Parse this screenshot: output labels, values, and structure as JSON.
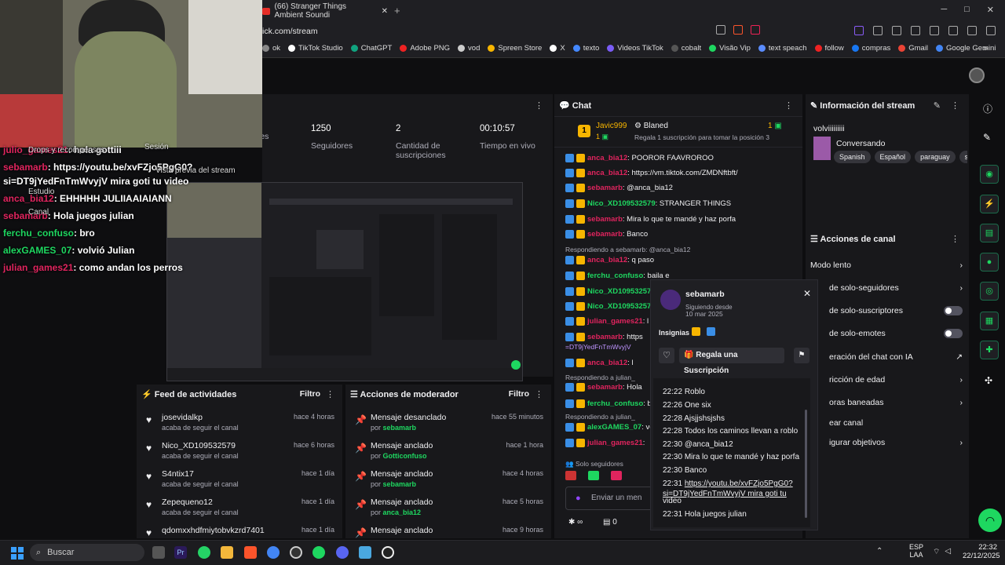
{
  "browser": {
    "tab_title": "(66) Stranger Things Ambient Soundi",
    "new_tab": "+",
    "url": "ick.com/stream",
    "window_controls": [
      "─",
      "□",
      "✕"
    ],
    "bookmarks": [
      "ok",
      "TikTok Studio",
      "ChatGPT",
      "Adobe PNG",
      "vod",
      "Spreen Store",
      "X",
      "texto",
      "Videos TikTok",
      "cobalt",
      "Visão Vip",
      "text speach",
      "follow",
      "compras",
      "Gmail",
      "Google Gemini"
    ]
  },
  "stats": {
    "items": [
      {
        "value": "",
        "label": "ores"
      },
      {
        "value": "1250",
        "label": "Seguidores"
      },
      {
        "value": "2",
        "label": "Cantidad de suscripciones"
      },
      {
        "value": "00:10:57",
        "label": "Tiempo en vivo"
      }
    ]
  },
  "overlay_chat": [
    {
      "user": "julio_games21",
      "text": ": hola gottiii",
      "color": "#e0245e"
    },
    {
      "user": "sebamarb",
      "text": ": https://youtu.be/xvFZjo5PgG0?",
      "color": "#e0245e"
    },
    {
      "user": "",
      "text": "si=DT9jYedFnTmWvyjV mira goti tu video",
      "color": "#fff"
    },
    {
      "user": "anca_bia12",
      "text": ": EHHHHH JULIIAAIAIANN",
      "color": "#e0245e"
    },
    {
      "user": "sebamarb",
      "text": ": Hola juegos julian",
      "color": "#e0245e"
    },
    {
      "user": "ferchu_confuso",
      "text": ": bro",
      "color": "#1ed760"
    },
    {
      "user": "alexGAMES_07",
      "text": ": volvió Julian",
      "color": "#1ed760"
    },
    {
      "user": "julian_games21",
      "text": ": como andan los perros",
      "color": "#e0245e"
    }
  ],
  "overlay_menu": [
    "Drops y recompensas",
    "Vista previa del stream",
    "Estudio",
    "Canal",
    "Sesión"
  ],
  "chat": {
    "title": "Chat",
    "top_user": "Javic999",
    "top_rank": "1",
    "top_badge": "Blaned",
    "top_count": "1",
    "top_cta": "Regala 1 suscripción para tomar la posición 3",
    "lines": [
      {
        "user": "anca_bia12",
        "text": ": POOROR FAAVROROO",
        "ucolor": "#e0245e"
      },
      {
        "user": "anca_bia12",
        "text": ": https://vm.tiktok.com/ZMDNftbft/",
        "ucolor": "#e0245e"
      },
      {
        "user": "sebamarb",
        "text": ": @anca_bia12",
        "ucolor": "#e0245e"
      },
      {
        "user": "Nico_XD109532579",
        "text": ": STRANGER THINGS",
        "ucolor": "#1ed760"
      },
      {
        "user": "sebamarb",
        "text": ": Mira lo que te mandé y haz porfa",
        "ucolor": "#e0245e"
      },
      {
        "user": "sebamarb",
        "text": ": Banco",
        "ucolor": "#e0245e"
      },
      {
        "user": "",
        "text": "Respondiendo a sebamarb: @anca_bia12",
        "ucolor": "#adadb8"
      },
      {
        "user": "anca_bia12",
        "text": ": q paso",
        "ucolor": "#e0245e"
      },
      {
        "user": "ferchu_confuso",
        "text": ": baila e",
        "ucolor": "#1ed760"
      },
      {
        "user": "Nico_XD109532579",
        "text": ": nc",
        "ucolor": "#1ed760"
      },
      {
        "user": "Nico_XD109532579",
        "text": ": /p",
        "ucolor": "#1ed760"
      },
      {
        "user": "julian_games21",
        "text": ": l",
        "ucolor": "#e0245e"
      },
      {
        "user": "sebamarb",
        "text": ": https",
        "ucolor": "#e0245e"
      },
      {
        "user": "",
        "text": "=DT9jYedFnTmWvyjV",
        "ucolor": "#bf94ff"
      },
      {
        "user": "anca_bia12",
        "text": ": l",
        "ucolor": "#e0245e"
      },
      {
        "user": "",
        "text": "Respondiendo a julian_",
        "ucolor": "#adadb8"
      },
      {
        "user": "sebamarb",
        "text": ": Hola",
        "ucolor": "#e0245e"
      },
      {
        "user": "ferchu_confuso",
        "text": ": bro",
        "ucolor": "#1ed760"
      },
      {
        "user": "",
        "text": "Respondiendo a julian_",
        "ucolor": "#adadb8"
      },
      {
        "user": "alexGAMES_07",
        "text": ": volvió J",
        "ucolor": "#1ed760"
      },
      {
        "user": "julian_games21",
        "text": ":",
        "ucolor": "#e0245e"
      }
    ],
    "followers_only": "Solo seguidores",
    "input_placeholder": "Enviar un men",
    "points": "0"
  },
  "info": {
    "title": "Información del stream",
    "stream_title": "volviiiiiiiii",
    "category": "Conversando",
    "tags": [
      "Spanish",
      "Español",
      "paraguay",
      "sp"
    ]
  },
  "actions": {
    "title": "Acciones de canal",
    "rows": [
      "Modo lento",
      "de solo-seguidores",
      "de solo-suscriptores",
      "de solo-emotes",
      "eración del chat con IA",
      "ricción de edad",
      "oras baneadas",
      "ear canal",
      "igurar objetivos"
    ]
  },
  "popup": {
    "username": "sebamarb",
    "following_label": "Siguiendo desde",
    "following_date": "10 mar 2025",
    "badges_label": "Insignias",
    "gift_label": "Regala una Suscripción",
    "messages": [
      {
        "time": "22:22",
        "text": "Roblo"
      },
      {
        "time": "22:26",
        "text": "One six"
      },
      {
        "time": "22:28",
        "text": "Ajsjjshsjshs"
      },
      {
        "time": "22:28",
        "text": "Todos los caminos llevan a roblo"
      },
      {
        "time": "22:30",
        "text": "@anca_bia12"
      },
      {
        "time": "22:30",
        "text": "Mira lo que te mandé y haz porfa"
      },
      {
        "time": "22:30",
        "text": "Banco"
      },
      {
        "time": "22:31",
        "text": "https://youtu.be/xvFZjo5PgG0?"
      },
      {
        "time": "",
        "text": "si=DT9jYedFnTmWvyjV mira goti tu"
      },
      {
        "time": "",
        "text": "video"
      },
      {
        "time": "22:31",
        "text": "Hola juegos julian"
      }
    ]
  },
  "feed": {
    "title": "Feed de actividades",
    "filter": "Filtro",
    "items": [
      {
        "user": "josevidalkp",
        "sub": "acaba de seguir el canal",
        "time": "hace 4 horas"
      },
      {
        "user": "Nico_XD109532579",
        "sub": "acaba de seguir el canal",
        "time": "hace 6 horas"
      },
      {
        "user": "S4ntix17",
        "sub": "acaba de seguir el canal",
        "time": "hace 1 día"
      },
      {
        "user": "Zepequeno12",
        "sub": "acaba de seguir el canal",
        "time": "hace 1 día"
      },
      {
        "user": "qdomxxhdfmiytobvkzrd7401",
        "sub": "",
        "time": "hace 1 día"
      }
    ]
  },
  "modactions": {
    "title": "Acciones de moderador",
    "filter": "Filtro",
    "items": [
      {
        "action": "Mensaje desanclado",
        "by": "por ",
        "user": "sebamarb",
        "time": "hace 55 minutos"
      },
      {
        "action": "Mensaje anclado",
        "by": "por ",
        "user": "Gotticonfuso",
        "time": "hace 1 hora"
      },
      {
        "action": "Mensaje anclado",
        "by": "por ",
        "user": "sebamarb",
        "time": "hace 4 horas"
      },
      {
        "action": "Mensaje anclado",
        "by": "por ",
        "user": "anca_bia12",
        "time": "hace 5 horas"
      },
      {
        "action": "Mensaje anclado",
        "by": "",
        "user": "",
        "time": "hace 9 horas"
      }
    ]
  },
  "taskbar": {
    "search": "Buscar",
    "lang1": "ESP",
    "lang2": "LAA",
    "time": "22:32",
    "date": "22/12/2025"
  }
}
